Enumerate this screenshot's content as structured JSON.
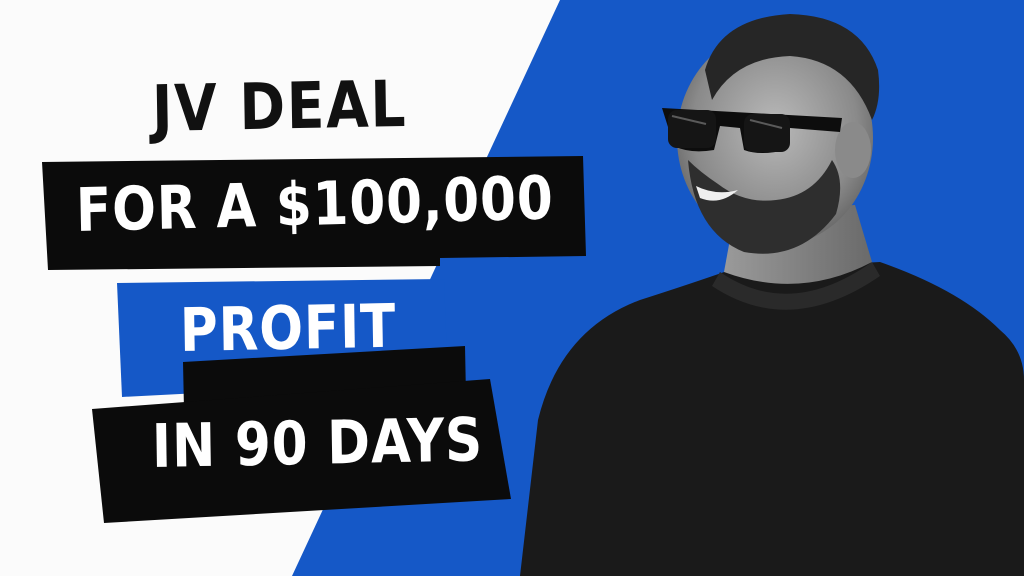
{
  "headline": {
    "line1": "JV DEAL",
    "line2": "FOR A $100,000",
    "line3": "PROFIT",
    "line4": "IN 90 DAYS"
  },
  "colors": {
    "background": "#fbfbfb",
    "accent_blue": "#1558c7",
    "banner_black": "#0b0b0b",
    "text_light": "#ffffff",
    "text_dark": "#111111"
  },
  "image": {
    "subject": "man-with-sunglasses-portrait",
    "style": "black-and-white"
  }
}
